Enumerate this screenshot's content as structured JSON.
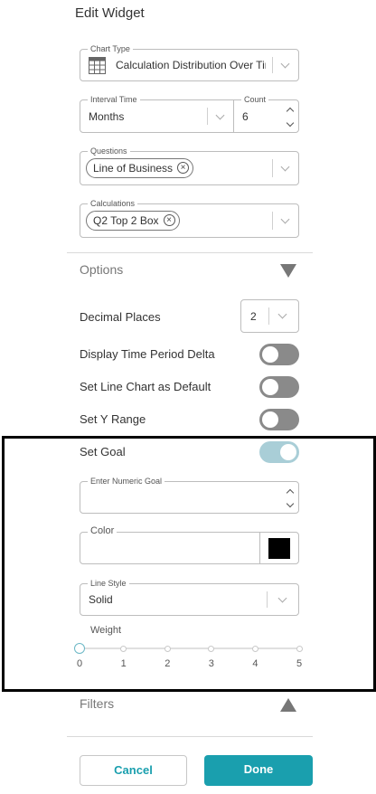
{
  "title": "Edit Widget",
  "chart_type": {
    "label": "Chart Type",
    "value": "Calculation Distribution Over Tir",
    "icon": "table-grid-icon"
  },
  "interval": {
    "label": "Interval Time",
    "value": "Months"
  },
  "count": {
    "label": "Count",
    "value": "6"
  },
  "questions": {
    "label": "Questions",
    "chip": "Line of Business"
  },
  "calculations": {
    "label": "Calculations",
    "chip": "Q2 Top 2 Box"
  },
  "options": {
    "header": "Options",
    "decimal_places": {
      "label": "Decimal Places",
      "value": "2"
    },
    "display_delta": {
      "label": "Display Time Period Delta",
      "on": false
    },
    "line_default": {
      "label": "Set Line Chart as Default",
      "on": false
    },
    "y_range": {
      "label": "Set Y Range",
      "on": false
    },
    "set_goal": {
      "label": "Set Goal",
      "on": true
    }
  },
  "goal": {
    "numeric_label": "Enter Numeric Goal",
    "numeric_value": "",
    "color_label": "Color",
    "color_value": "#000000",
    "line_style_label": "Line Style",
    "line_style_value": "Solid",
    "weight_label": "Weight",
    "weight_ticks": [
      "0",
      "1",
      "2",
      "3",
      "4",
      "5"
    ],
    "weight_value": 0
  },
  "filters": {
    "header": "Filters"
  },
  "actions": {
    "cancel": "Cancel",
    "done": "Done"
  },
  "colors": {
    "accent": "#1a9fae",
    "toggle_on": "#a9ced7",
    "toggle_off": "#8a8a8a"
  }
}
